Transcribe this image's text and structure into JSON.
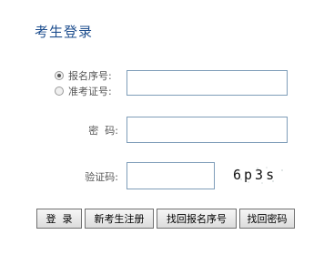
{
  "title": "考生登录",
  "login_type": {
    "options": [
      {
        "label": "报名序号:",
        "checked": true
      },
      {
        "label": "准考证号:",
        "checked": false
      }
    ]
  },
  "password": {
    "label": "密  码:",
    "value": ""
  },
  "id_field": {
    "value": ""
  },
  "captcha": {
    "label": "验证码:",
    "value": "",
    "image_text": "6p3s"
  },
  "buttons": {
    "login": "登  录",
    "register": "新考生注册",
    "find_reg_no": "找回报名序号",
    "find_password": "找回密码"
  }
}
